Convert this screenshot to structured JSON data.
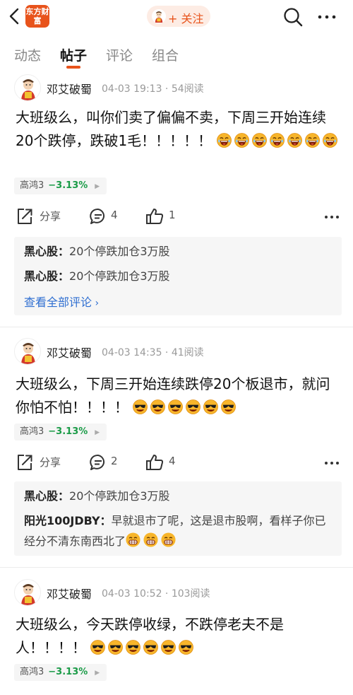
{
  "header": {
    "logo_text": "东方财富",
    "follow_label": "+ 关注",
    "icons": [
      "back-arrow-icon",
      "search-icon",
      "more-icon"
    ]
  },
  "tabs": [
    {
      "label": "动态",
      "active": false
    },
    {
      "label": "帖子",
      "active": true
    },
    {
      "label": "评论",
      "active": false
    },
    {
      "label": "组合",
      "active": false
    }
  ],
  "colors": {
    "accent": "#e8531b",
    "down_green": "#1a9b47",
    "link_blue": "#2f6fd1"
  },
  "posts": [
    {
      "author": "邓艾破蜀",
      "meta": "04-03 19:13 · 54阅读",
      "text": "大班级么，叫你们卖了偏偏不卖，下周三开始连续20个跌停，跌破1毛！！！！！",
      "emoji_count": 7,
      "emoji": "laughing-emoji",
      "stock_name": "高鸿3",
      "stock_change": "−3.13%",
      "share_label": "分享",
      "comment_count": "4",
      "like_count": "1",
      "comments": [
        {
          "user": "黑心股：",
          "text": "20个停跌加仓3万股"
        },
        {
          "user": "黑心股：",
          "text": "20个停跌加仓3万股"
        }
      ],
      "see_all": "查看全部评论"
    },
    {
      "author": "邓艾破蜀",
      "meta": "04-03 14:35 · 41阅读",
      "text": "大班级么，下周三开始连续跌停20个板退市，就问你怕不怕！！！！",
      "emoji_count": 6,
      "emoji": "sunglasses-emoji",
      "stock_name": "高鸿3",
      "stock_change": "−3.13%",
      "share_label": "分享",
      "comment_count": "2",
      "like_count": "4",
      "comments": [
        {
          "user": "黑心股：",
          "text": "20个停跌加仓3万股"
        },
        {
          "user": "阳光100JDBY：",
          "text": "早就退市了呢，这是退市股啊，看样子你已经分不清东南西北了"
        }
      ]
    },
    {
      "author": "邓艾破蜀",
      "meta": "04-03 10:52 · 103阅读",
      "text": "大班级么，今天跌停收绿，不跌停老夫不是人！！！！",
      "emoji_count": 6,
      "emoji": "sunglasses-emoji",
      "stock_name": "高鸿3",
      "stock_change": "−3.13%"
    }
  ]
}
